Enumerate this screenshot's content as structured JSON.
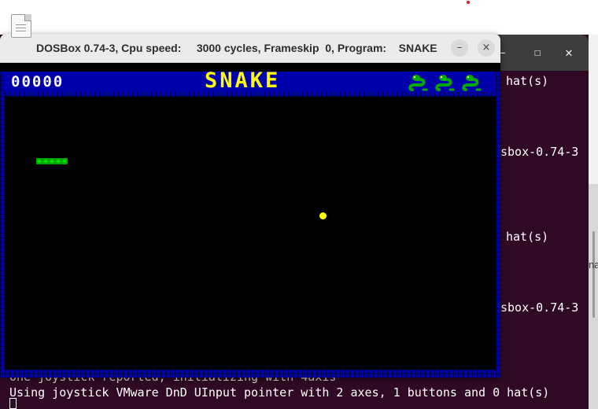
{
  "dosbox": {
    "title": "DOSBox 0.74-3, Cpu speed:     3000 cycles, Frameskip  0, Program:    SNAKE",
    "minimize_label": "–",
    "close_label": "×"
  },
  "terminal": {
    "minimize_label": "–",
    "maximize_label": "☐",
    "close_label": "✕",
    "side_fragments": [
      "hat(s)",
      "sbox-0.74-3",
      "hat(s)",
      "sbox-0.74-3"
    ],
    "bottom_lines": [
      "One joystick reported, initializing with 4axis",
      "Using joystick VMware DnD UInput pointer with 2 axes, 1 buttons and 0 hat(s)"
    ],
    "right_fragment": "na"
  },
  "game": {
    "score": "00000",
    "title": "SNAKE",
    "lives": 3,
    "colors": {
      "border": "#0000aa",
      "title": "#ffff00",
      "snake": "#00aa00",
      "food": "#ffff00",
      "score": "#ffffff"
    },
    "snake_length_segments": 5
  }
}
